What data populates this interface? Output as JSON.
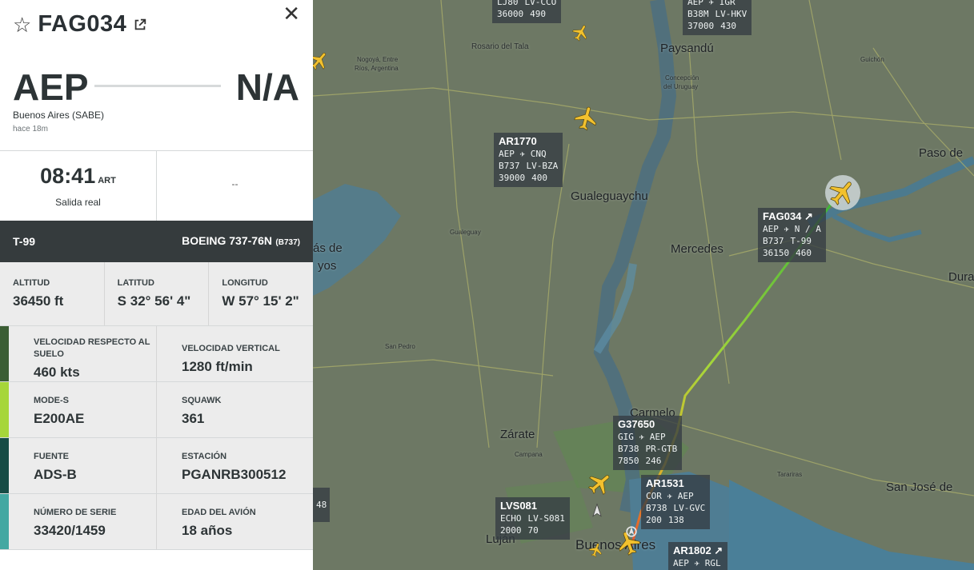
{
  "flight": {
    "callsign": "FAG034",
    "from_iata": "AEP",
    "to_iata": "N/A",
    "from_name": "Buenos Aires (SABE)",
    "time_ago": "hace 18m"
  },
  "times": {
    "departure_time": "08:41",
    "departure_tz": "ART",
    "departure_label": "Salida real",
    "arrival_placeholder": "--"
  },
  "aircraft": {
    "registration": "T-99",
    "model": "BOEING 737-76N",
    "type_code": "(B737)"
  },
  "position": {
    "altitude_label": "ALTITUD",
    "altitude": "36450 ft",
    "latitude_label": "LATITUD",
    "latitude": "S 32° 56' 4\"",
    "longitude_label": "LONGITUD",
    "longitude": "W 57° 15' 2\""
  },
  "details": [
    {
      "stripe": "#3b5e35",
      "left_label": "VELOCIDAD RESPECTO AL SUELO",
      "left_value": "460 kts",
      "right_label": "VELOCIDAD VERTICAL",
      "right_value": "1280 ft/min"
    },
    {
      "stripe": "#a6d63a",
      "left_label": "MODE-S",
      "left_value": "E200AE",
      "right_label": "SQUAWK",
      "right_value": "361"
    },
    {
      "stripe": "#164c45",
      "left_label": "FUENTE",
      "left_value": "ADS-B",
      "right_label": "ESTACIÓN",
      "right_value": "PGANRB300512"
    },
    {
      "stripe": "#43a8a2",
      "left_label": "NÚMERO DE SERIE",
      "left_value": "33420/1459",
      "right_label": "EDAD DEL AVIÓN",
      "right_value": "18 años"
    }
  ],
  "map": {
    "cities": {
      "paysandu": "Paysandú",
      "gualeguaychu": "Gualeguaychu",
      "mercedes": "Mercedes",
      "carmelo": "Carmelo",
      "zarate": "Zárate",
      "lujan": "Luján",
      "buenos_aires": "Buenos Aires",
      "paso_de": "Paso de",
      "dura": "Dura",
      "san_jose": "San José de",
      "rosario_del_tala": "Rosario del Tala",
      "nogoya": "Nogoyá, Entre",
      "nogoya2": "Ríos, Argentina",
      "concepcion1": "Concepción",
      "concepcion2": "del Uruguay",
      "guichon": "Guichón",
      "gualeguay": "Gualeguay",
      "san_pedro": "San Pedro",
      "campana": "Campana",
      "tarariras": "Tarariras",
      "victoria1": "ás de",
      "victoria2": "yos"
    },
    "flights": [
      {
        "id": "top1",
        "l1": "LJ80",
        "l1b": "LV-CCO",
        "l2": "36000",
        "l2b": "490"
      },
      {
        "id": "top2",
        "l1": "AEP ✈ IGR",
        "l2": "B38M",
        "l2b": "LV-HKV",
        "l3": "37000",
        "l3b": "430"
      },
      {
        "id": "ar1770",
        "callsign": "AR1770",
        "route": "AEP ✈ CNQ",
        "type": "B737",
        "reg": "LV-BZA",
        "alt": "39000",
        "speed": "400"
      },
      {
        "id": "fag034",
        "callsign": "FAG034 ↗",
        "route": "AEP ✈ N / A",
        "type": "B737",
        "reg": "T-99",
        "alt": "36150",
        "speed": "460"
      },
      {
        "id": "g37650",
        "callsign": "G37650",
        "route": "GIG ✈ AEP",
        "type": "B738",
        "reg": "PR-GTB",
        "alt": "7850",
        "speed": "246"
      },
      {
        "id": "ar1531",
        "callsign": "AR1531",
        "route": "COR ✈ AEP",
        "type": "B738",
        "reg": "LV-GVC",
        "alt": "200",
        "speed": "138"
      },
      {
        "id": "lvs081",
        "callsign": "LVS081",
        "route": "ECHO",
        "reg": "LV-S081",
        "alt": "2000",
        "speed": "70"
      },
      {
        "id": "ar1802",
        "callsign": "AR1802 ↗",
        "route": "AEP ✈ RGL"
      }
    ],
    "edge_number": "48"
  }
}
